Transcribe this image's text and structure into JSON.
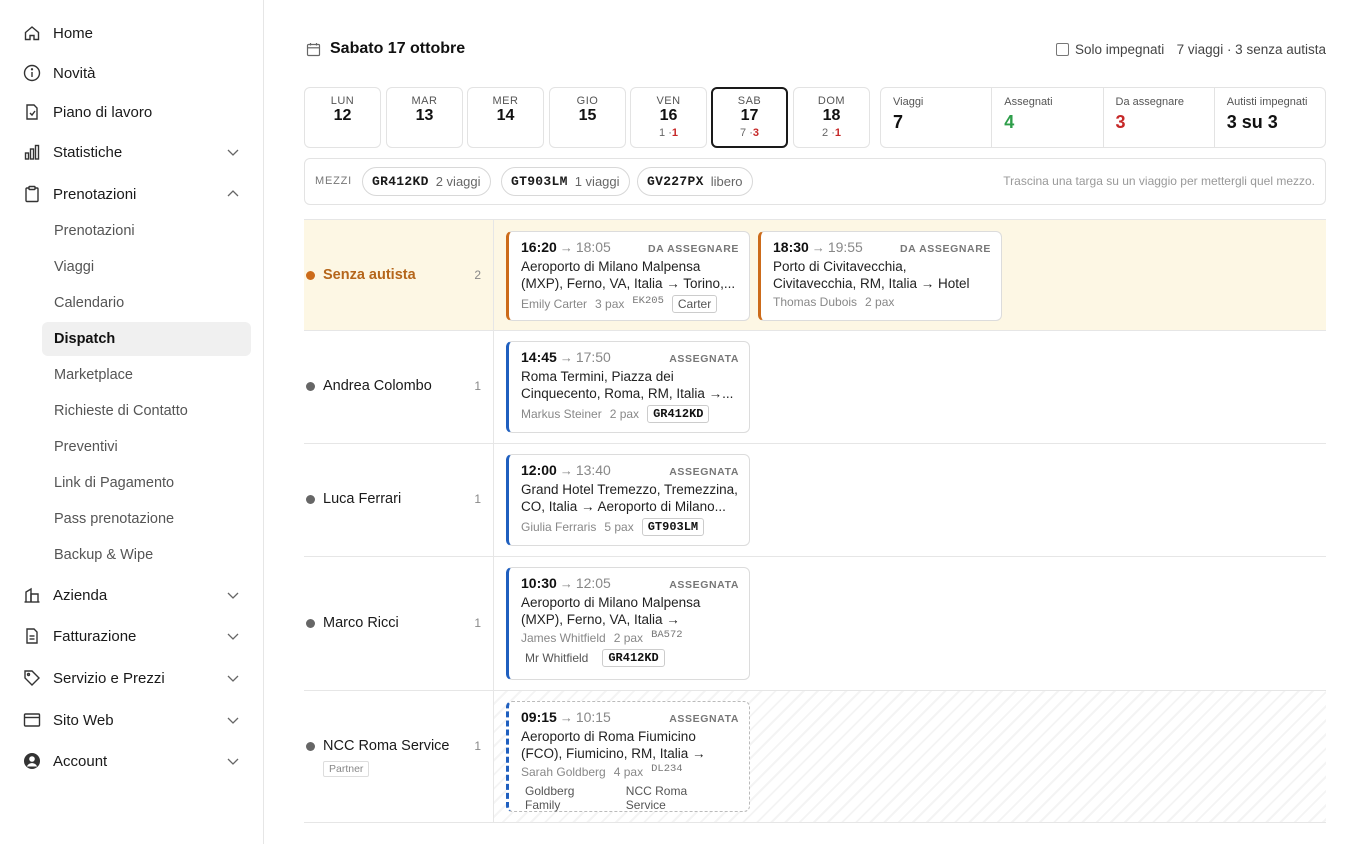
{
  "sidebar": {
    "items": [
      {
        "label": "Home",
        "icon": "home-icon"
      },
      {
        "label": "Novità",
        "icon": "info-icon"
      },
      {
        "label": "Piano di lavoro",
        "icon": "file-icon"
      },
      {
        "label": "Statistiche",
        "icon": "chart-icon"
      },
      {
        "label": "Prenotazioni",
        "icon": "clipboard-icon"
      },
      {
        "label": "Azienda",
        "icon": "building-icon"
      },
      {
        "label": "Fatturazione",
        "icon": "invoice-icon"
      },
      {
        "label": "Servizio e Prezzi",
        "icon": "tag-icon"
      },
      {
        "label": "Sito Web",
        "icon": "browser-icon"
      },
      {
        "label": "Account",
        "icon": "user-icon"
      }
    ],
    "subitems": [
      {
        "label": "Prenotazioni"
      },
      {
        "label": "Viaggi"
      },
      {
        "label": "Calendario"
      },
      {
        "label": "Dispatch"
      },
      {
        "label": "Marketplace"
      },
      {
        "label": "Richieste di Contatto"
      },
      {
        "label": "Preventivi"
      },
      {
        "label": "Link di Pagamento"
      },
      {
        "label": "Pass prenotazione"
      },
      {
        "label": "Backup & Wipe"
      }
    ]
  },
  "header": {
    "title": "Sabato 17 ottobre",
    "filter_label": "Solo impegnati",
    "summary": "7 viaggi · 3 senza autista"
  },
  "days": [
    {
      "name": "LUN",
      "num": "12",
      "count": "",
      "unassigned": ""
    },
    {
      "name": "MAR",
      "num": "13",
      "count": "",
      "unassigned": ""
    },
    {
      "name": "MER",
      "num": "14",
      "count": "",
      "unassigned": ""
    },
    {
      "name": "GIO",
      "num": "15",
      "count": "",
      "unassigned": ""
    },
    {
      "name": "VEN",
      "num": "16",
      "count": "1 ·",
      "unassigned": "1"
    },
    {
      "name": "SAB",
      "num": "17",
      "count": "7 ·",
      "unassigned": "3"
    },
    {
      "name": "DOM",
      "num": "18",
      "count": "2 ·",
      "unassigned": "1"
    }
  ],
  "stats": [
    {
      "label": "Viaggi",
      "value": "7"
    },
    {
      "label": "Assegnati",
      "value": "4"
    },
    {
      "label": "Da assegnare",
      "value": "3"
    },
    {
      "label": "Autisti impegnati",
      "value": "3 su 3"
    }
  ],
  "colors": {
    "accent_orange": "#cc6b1a",
    "accent_blue": "#1f5fbf",
    "green": "#2e9e4a",
    "red": "#c62828",
    "unassigned_bg": "#fdf7e4"
  },
  "mezzi": {
    "label": "MEZZI",
    "plates": [
      {
        "plate": "GR412KD",
        "info": "2 viaggi"
      },
      {
        "plate": "GT903LM",
        "info": "1 viaggi"
      },
      {
        "plate": "GV227PX",
        "info": "libero"
      }
    ],
    "hint": "Trascina una targa su un viaggio per mettergli quel mezzo."
  },
  "rows": [
    {
      "name": "Senza autista",
      "count": "2"
    },
    {
      "name": "Andrea Colombo",
      "count": "1"
    },
    {
      "name": "Luca Ferrari",
      "count": "1"
    },
    {
      "name": "Marco Ricci",
      "count": "1"
    },
    {
      "name": "NCC Roma Service",
      "count": "1",
      "badge": "Partner"
    }
  ],
  "trips": [
    {
      "start": "16:20",
      "end": "18:05",
      "status": "DA ASSEGNARE",
      "route": "Aeroporto di Milano Malpensa (MXP), Ferno, VA, Italia → Torino,...",
      "client": "Emily Carter",
      "pax": "3 pax",
      "flight": "EK205",
      "tag": "Carter"
    },
    {
      "start": "18:30",
      "end": "19:55",
      "status": "DA ASSEGNARE",
      "route": "Porto di Civitavecchia, Civitavecchia, RM, Italia → Hotel Artemide, Via...",
      "client": "Thomas Dubois",
      "pax": "2 pax"
    },
    {
      "start": "14:45",
      "end": "17:50",
      "status": "ASSEGNATA",
      "route": "Roma Termini, Piazza dei Cinquecento, Roma, RM, Italia →...",
      "client": "Markus Steiner",
      "pax": "2 pax",
      "plate": "GR412KD"
    },
    {
      "start": "12:00",
      "end": "13:40",
      "status": "ASSEGNATA",
      "route": "Grand Hotel Tremezzo, Tremezzina, CO, Italia → Aeroporto di Milano...",
      "client": "Giulia Ferraris",
      "pax": "5 pax",
      "plate": "GT903LM"
    },
    {
      "start": "10:30",
      "end": "12:05",
      "status": "ASSEGNATA",
      "route": "Aeroporto di Milano Malpensa (MXP), Ferno, VA, Italia → Bellagio...",
      "client": "James Whitfield",
      "pax": "2 pax",
      "flight": "BA572",
      "tag": "Mr Whitfield",
      "plate": "GR412KD"
    },
    {
      "start": "09:15",
      "end": "10:15",
      "status": "ASSEGNATA",
      "route": "Aeroporto di Roma Fiumicino (FCO), Fiumicino, RM, Italia → Porto di...",
      "client": "Sarah Goldberg",
      "pax": "4 pax",
      "flight": "DL234",
      "tag": "Goldberg Family",
      "partner": "NCC Roma Service"
    }
  ]
}
